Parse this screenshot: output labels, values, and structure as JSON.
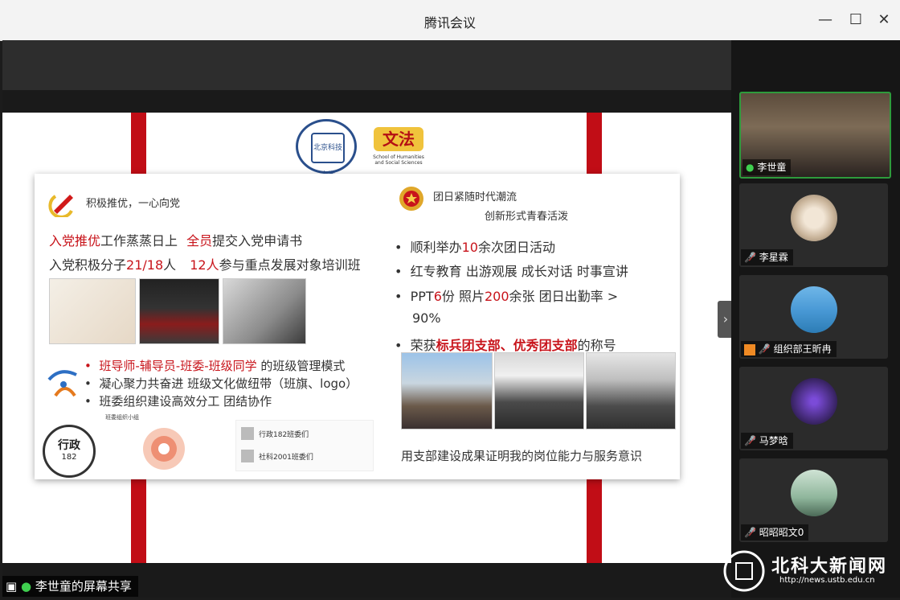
{
  "window": {
    "title": "腾讯会议",
    "minimize": "—",
    "maximize": "☐",
    "close": "✕"
  },
  "slide": {
    "logo_seal_text": "北京科技大学",
    "logo2_badge": "文法",
    "logo2_sub": "School of Humanities and Social Sciences",
    "left": {
      "heading": "积极推优，一心向党",
      "line1_red1": "入党推优",
      "line1_mid": "工作蒸蒸日上",
      "line1_red2": "全员",
      "line1_end": "提交入党申请书",
      "line2_pre": "入党积极分子",
      "line2_red1": "21/18",
      "line2_mid": "人",
      "line2_red2": "12人",
      "line2_end": "参与重点发展对象培训班",
      "bullet1_red": "班导师-辅导员-班委-班级同学",
      "bullet1_end": "的班级管理模式",
      "bullet2": "凝心聚力共奋进 班级文化做纽带（班旗、logo）",
      "bullet3": "班委组织建设高效分工 团结协作",
      "class_badge_top": "行政",
      "class_badge_bottom": "182",
      "org_title": "班委组织小组",
      "chat1": "行政182班委们",
      "chat2": "社科2001班委们"
    },
    "right": {
      "heading1": "团日紧随时代潮流",
      "heading2": "创新形式青春活泼",
      "b1_pre": "顺利举办",
      "b1_red": "10",
      "b1_end": "余次团日活动",
      "b2": "红专教育 出游观展 成长对话 时事宣讲",
      "b3_pre": "PPT",
      "b3_red1": "6",
      "b3_mid1": "份  照片",
      "b3_red2": "200",
      "b3_mid2": "余张  团日出勤率 >",
      "b3_red3": "90%",
      "b4_pre": "荣获",
      "b4_red": "标兵团支部、优秀团支部",
      "b4_end": "的称号",
      "footer": "用支部建设成果证明我的岗位能力与服务意识"
    }
  },
  "participants": [
    {
      "name": "李世童",
      "mic": "on",
      "active": true
    },
    {
      "name": "李星霖",
      "mic": "muted"
    },
    {
      "name": "组织部王昕冉",
      "mic": "muted"
    },
    {
      "name": "马梦晗",
      "mic": "muted"
    },
    {
      "name": "昭昭昭文0",
      "mic": "muted"
    }
  ],
  "share_label": "李世童的屏幕共享",
  "watermark": {
    "title": "北科大新闻网",
    "url": "http://news.ustb.edu.cn"
  },
  "colors": {
    "accent_red": "#c8141b",
    "active_green": "#2e9b3c"
  }
}
